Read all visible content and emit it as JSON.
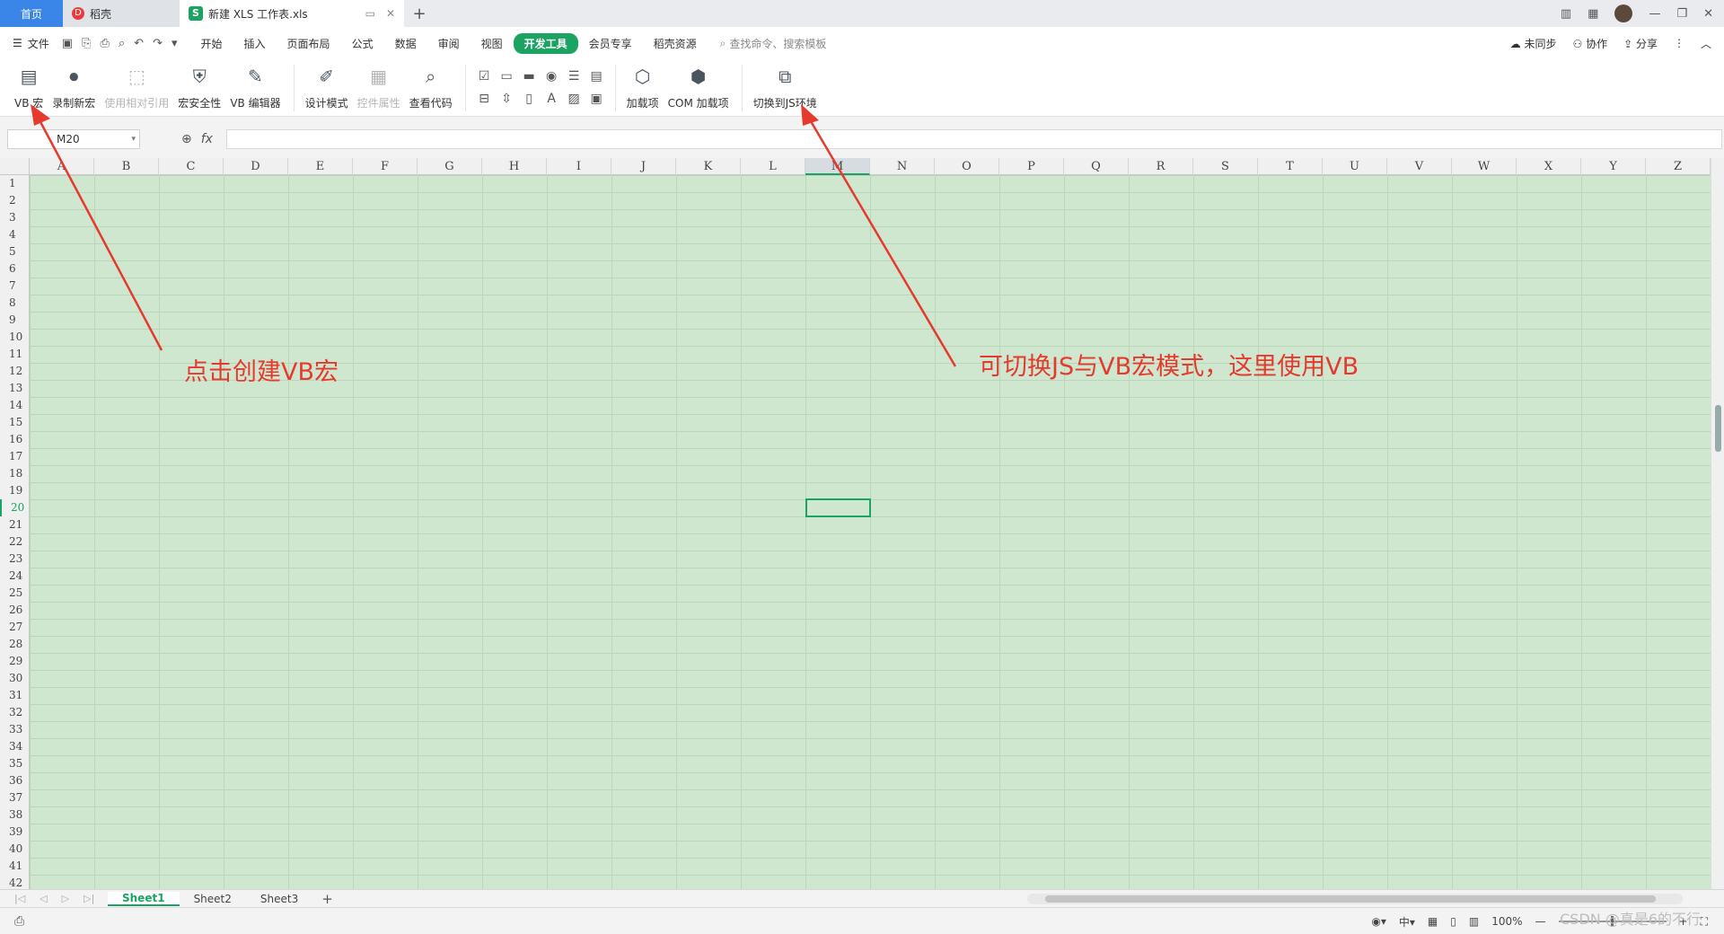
{
  "tabs": {
    "home": "首页",
    "docer": "稻壳",
    "active_doc": "新建 XLS 工作表.xls"
  },
  "menubar": {
    "file": "文件",
    "items": [
      "开始",
      "插入",
      "页面布局",
      "公式",
      "数据",
      "审阅",
      "视图",
      "开发工具",
      "会员专享",
      "稻壳资源"
    ],
    "active": "开发工具",
    "search_placeholder": "查找命令、搜索模板",
    "sync": "未同步",
    "collab": "协作",
    "share": "分享"
  },
  "ribbon": {
    "vb_macro": "VB 宏",
    "record_macro": "录制新宏",
    "relative_ref": "使用相对引用",
    "macro_security": "宏安全性",
    "vb_editor": "VB 编辑器",
    "design_mode": "设计模式",
    "control_props": "控件属性",
    "view_code": "查看代码",
    "addins": "加载项",
    "com_addins": "COM 加载项",
    "switch_js": "切换到JS环境"
  },
  "formula": {
    "name_box": "M20",
    "fx": "fx"
  },
  "columns": [
    "A",
    "B",
    "C",
    "D",
    "E",
    "F",
    "G",
    "H",
    "I",
    "J",
    "K",
    "L",
    "M",
    "N",
    "O",
    "P",
    "Q",
    "R",
    "S",
    "T",
    "U",
    "V",
    "W",
    "X",
    "Y",
    "Z"
  ],
  "rows": [
    "1",
    "2",
    "3",
    "4",
    "5",
    "6",
    "7",
    "8",
    "9",
    "10",
    "11",
    "12",
    "13",
    "14",
    "15",
    "16",
    "17",
    "18",
    "19",
    "20",
    "21",
    "22",
    "23",
    "24",
    "25",
    "26",
    "27",
    "28",
    "29",
    "30",
    "31",
    "32",
    "33",
    "34",
    "35",
    "36",
    "37",
    "38",
    "39",
    "40",
    "41",
    "42"
  ],
  "selected": {
    "column": "M",
    "row": "20"
  },
  "sheets": [
    "Sheet1",
    "Sheet2",
    "Sheet3"
  ],
  "active_sheet": "Sheet1",
  "status": {
    "zoom": "100%"
  },
  "annotations": {
    "left": "点击创建VB宏",
    "right": "可切换JS与VB宏模式，这里使用VB"
  },
  "watermark": "CSDN @真是6的不行",
  "colors": {
    "accent": "#1ba362",
    "sheet_bg": "#cfe6cf",
    "annotation": "#e53a2e",
    "home_tab": "#3a86e8"
  }
}
